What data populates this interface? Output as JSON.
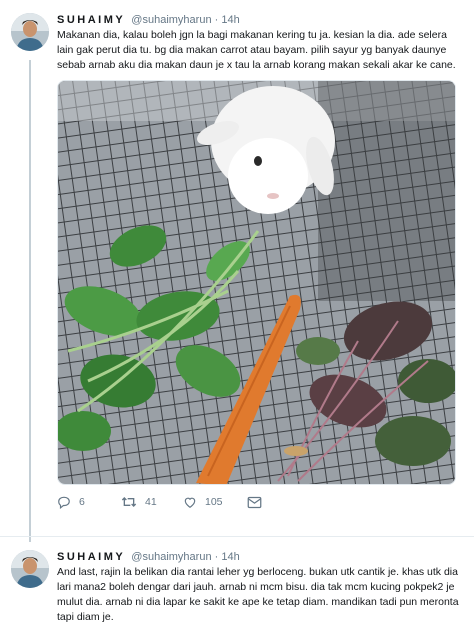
{
  "tweets": [
    {
      "user": {
        "name": "SUHAIMY",
        "handle": "@suhaimyharun",
        "avatar_icon": "user-avatar-photo"
      },
      "separator": "·",
      "time": "14h",
      "text": "Makanan dia, kalau boleh jgn la bagi makanan kering tu ja. kesian la dia. ade selera lain gak perut dia tu. bg dia makan carrot atau bayam. pilih sayur yg banyak daunye sebab arnab aku dia makan daun je x tau la arnab korang makan sekali akar ke cane.",
      "media": {
        "kind": "photo",
        "subject": "white rabbit in cage with spinach and a carrot"
      },
      "actions": {
        "reply": {
          "icon": "reply-icon",
          "count": "6"
        },
        "retweet": {
          "icon": "retweet-icon",
          "count": "41"
        },
        "like": {
          "icon": "heart-icon",
          "count": "105"
        },
        "dm": {
          "icon": "envelope-icon"
        }
      }
    },
    {
      "user": {
        "name": "SUHAIMY",
        "handle": "@suhaimyharun",
        "avatar_icon": "user-avatar-photo"
      },
      "separator": "·",
      "time": "14h",
      "text": "And last, rajin la belikan dia rantai leher yg berloceng. bukan utk cantik je. khas utk dia lari mana2 boleh dengar dari jauh. arnab ni mcm bisu. dia tak mcm kucing pokpek2 je mulut dia. arnab ni dia lapar ke sakit ke ape ke tetap diam. mandikan tadi pun meronta tapi diam je."
    }
  ],
  "colors": {
    "muted": "#657786",
    "border": "#e6ecf0",
    "thread_line": "#c4cfd6"
  }
}
